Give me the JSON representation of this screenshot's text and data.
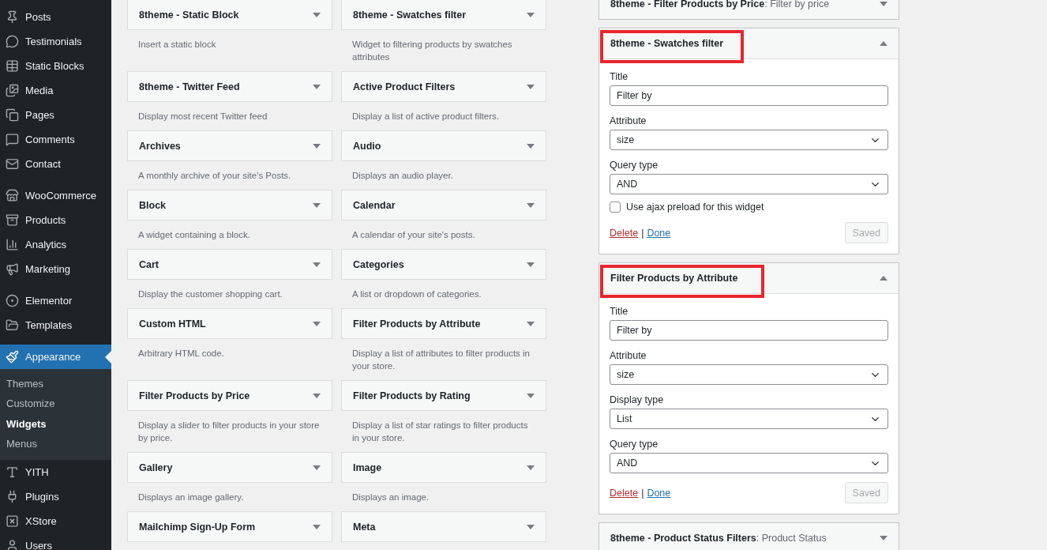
{
  "sidebar": {
    "groups": [
      {
        "items": [
          {
            "label": "Posts",
            "selected": false
          },
          {
            "label": "Testimonials",
            "selected": false
          },
          {
            "label": "Static Blocks",
            "selected": false
          },
          {
            "label": "Media",
            "selected": false
          },
          {
            "label": "Pages",
            "selected": false
          },
          {
            "label": "Comments",
            "selected": false
          },
          {
            "label": "Contact",
            "selected": false
          }
        ]
      },
      {
        "items": [
          {
            "label": "WooCommerce",
            "selected": false
          },
          {
            "label": "Products",
            "selected": false
          },
          {
            "label": "Analytics",
            "selected": false
          },
          {
            "label": "Marketing",
            "selected": false
          }
        ]
      },
      {
        "items": [
          {
            "label": "Elementor",
            "selected": false
          },
          {
            "label": "Templates",
            "selected": false
          }
        ]
      },
      {
        "items": [
          {
            "label": "Appearance",
            "selected": true,
            "children": [
              {
                "label": "Themes",
                "selected": false
              },
              {
                "label": "Customize",
                "selected": false
              },
              {
                "label": "Widgets",
                "selected": true
              },
              {
                "label": "Menus",
                "selected": false
              }
            ]
          },
          {
            "label": "YITH",
            "selected": false
          },
          {
            "label": "Plugins",
            "selected": false
          },
          {
            "label": "XStore",
            "selected": false
          },
          {
            "label": "Users",
            "selected": false
          }
        ]
      }
    ]
  },
  "available_widgets": [
    {
      "title": "8theme - Static Block",
      "description": "Insert a static block"
    },
    {
      "title": "8theme - Swatches filter",
      "description": "Widget to filtering products by swatches attributes"
    },
    {
      "title": "8theme - Twitter Feed",
      "description": "Display most recent Twitter feed"
    },
    {
      "title": "Active Product Filters",
      "description": "Display a list of active product filters."
    },
    {
      "title": "Archives",
      "description": "A monthly archive of your site's Posts."
    },
    {
      "title": "Audio",
      "description": "Displays an audio player."
    },
    {
      "title": "Block",
      "description": "A widget containing a block."
    },
    {
      "title": "Calendar",
      "description": "A calendar of your site's posts."
    },
    {
      "title": "Cart",
      "description": "Display the customer shopping cart."
    },
    {
      "title": "Categories",
      "description": "A list or dropdown of categories."
    },
    {
      "title": "Custom HTML",
      "description": "Arbitrary HTML code."
    },
    {
      "title": "Filter Products by Attribute",
      "description": "Display a list of attributes to filter products in your store."
    },
    {
      "title": "Filter Products by Price",
      "description": "Display a slider to filter products in your store by price."
    },
    {
      "title": "Filter Products by Rating",
      "description": "Display a list of star ratings to filter products in your store."
    },
    {
      "title": "Gallery",
      "description": "Displays an image gallery."
    },
    {
      "title": "Image",
      "description": "Displays an image."
    },
    {
      "title": "Mailchimp Sign-Up Form"
    },
    {
      "title": "Meta"
    }
  ],
  "sidebar_widgets": [
    {
      "title": "8theme - Filter Products by Price",
      "subtitle": ": Filter by price",
      "expanded": false,
      "highlighted": false
    },
    {
      "title": "8theme - Swatches filter",
      "expanded": true,
      "highlighted": true,
      "fields": [
        {
          "kind": "text",
          "label": "Title",
          "value": "Filter by"
        },
        {
          "kind": "select",
          "label": "Attribute",
          "value": "size"
        },
        {
          "kind": "select",
          "label": "Query type",
          "value": "AND"
        },
        {
          "kind": "checkbox",
          "label": "Use ajax preload for this widget",
          "checked": false
        }
      ],
      "delete": "Delete",
      "separator": "|",
      "done": "Done",
      "save": {
        "label": "Saved",
        "disabled": true
      }
    },
    {
      "title": "Filter Products by Attribute",
      "expanded": true,
      "highlighted": true,
      "fields": [
        {
          "kind": "text",
          "label": "Title",
          "value": "Filter by"
        },
        {
          "kind": "select",
          "label": "Attribute",
          "value": "size"
        },
        {
          "kind": "select",
          "label": "Display type",
          "value": "List"
        },
        {
          "kind": "select",
          "label": "Query type",
          "value": "AND"
        }
      ],
      "delete": "Delete",
      "separator": "|",
      "done": "Done",
      "save": {
        "label": "Saved",
        "disabled": true
      }
    },
    {
      "title": "8theme - Product Status Filters",
      "subtitle": ": Product Status",
      "expanded": false,
      "highlighted": false
    }
  ]
}
